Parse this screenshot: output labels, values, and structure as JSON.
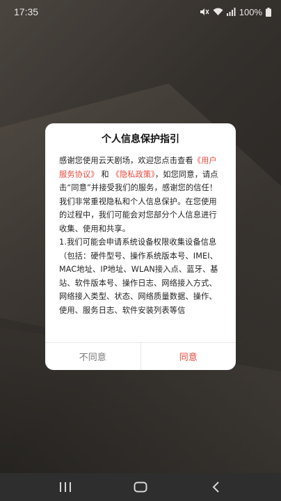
{
  "status_bar": {
    "time": "17:35",
    "battery_percent": "100%",
    "icons": [
      "mute-icon",
      "wifi-icon",
      "signal-icon",
      "battery-icon"
    ]
  },
  "dialog": {
    "title": "个人信息保护指引",
    "intro_prefix": "感谢您使用云天剧场，欢迎您点击查看",
    "user_agreement_link": "《用户服务协议》",
    "and_text": "和",
    "privacy_policy_link": "《隐私政策》",
    "intro_suffix": "，如您同意，请点击“同意”并接受我们的服务，感谢您的信任！",
    "paragraph2": "我们非常重视隐私和个人信息保护。在您使用的过程中，我们可能会对您部分个人信息进行收集、使用和共享。",
    "paragraph3": "1.我们可能会申请系统设备权限收集设备信息（包括：硬件型号、操作系统版本号、IMEI、MAC地址、IP地址、WLAN接入点、蓝牙、基站、软件版本号、操作日志、网络接入方式、网络接入类型、状态、网络质量数据、操作、使用、服务日志、软件安装列表等信",
    "disagree_label": "不同意",
    "agree_label": "同意",
    "link_color": "#e8493d"
  },
  "nav_bar": {
    "buttons": [
      "recent-apps-icon",
      "home-icon",
      "back-icon"
    ]
  }
}
